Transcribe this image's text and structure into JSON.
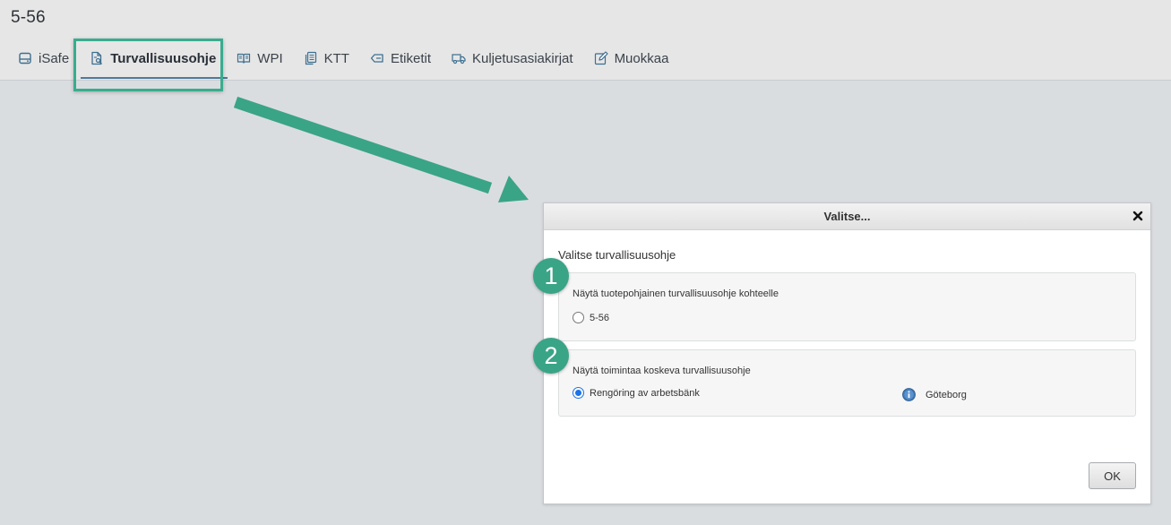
{
  "header": {
    "title": "5-56"
  },
  "tabs": [
    {
      "label": "iSafe",
      "icon": "drive-icon",
      "active": false
    },
    {
      "label": "Turvallisuusohje",
      "icon": "document-search-icon",
      "active": true
    },
    {
      "label": "WPI",
      "icon": "book-icon",
      "active": false
    },
    {
      "label": "KTT",
      "icon": "documents-icon",
      "active": false
    },
    {
      "label": "Etiketit",
      "icon": "tag-icon",
      "active": false
    },
    {
      "label": "Kuljetusasiakirjat",
      "icon": "truck-icon",
      "active": false
    },
    {
      "label": "Muokkaa",
      "icon": "edit-icon",
      "active": false
    }
  ],
  "dialog": {
    "title": "Valitse...",
    "heading": "Valitse turvallisuusohje",
    "group1": {
      "label": "Näytä tuotepohjainen turvallisuusohje kohteelle",
      "option": "5-56",
      "checked": false
    },
    "group2": {
      "label": "Näytä toimintaa koskeva turvallisuusohje",
      "option": "Rengöring av arbetsbänk",
      "checked": true,
      "location": "Göteborg"
    },
    "ok_label": "OK"
  },
  "annotations": {
    "badge1": "1",
    "badge2": "2",
    "accent_color": "#3aa487"
  }
}
